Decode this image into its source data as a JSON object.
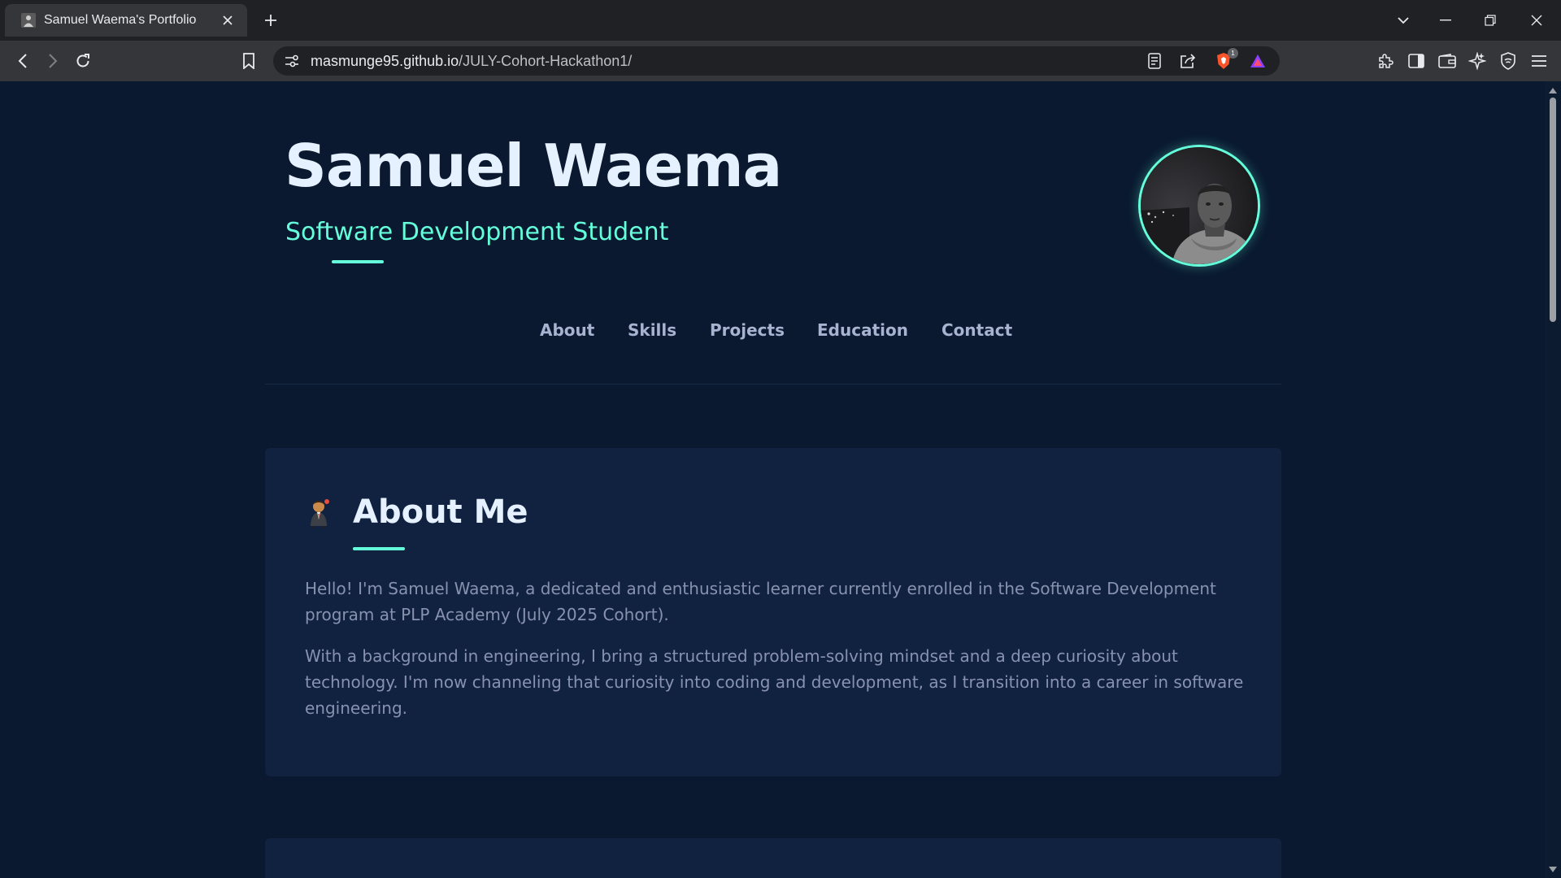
{
  "browser": {
    "tab": {
      "title": "Samuel Waema's Portfolio"
    },
    "address": {
      "host": "masmunge95.github.io",
      "path": "/JULY-Cohort-Hackathon1/"
    },
    "brave_shield_count": "1"
  },
  "hero": {
    "name": "Samuel Waema",
    "subtitle": "Software Development Student"
  },
  "nav": {
    "items": [
      "About",
      "Skills",
      "Projects",
      "Education",
      "Contact"
    ]
  },
  "about": {
    "title": "About Me",
    "paragraphs": [
      "Hello! I'm Samuel Waema, a dedicated and enthusiastic learner currently enrolled in the Software Development program at PLP Academy (July 2025 Cohort).",
      "With a background in engineering, I bring a structured problem-solving mindset and a deep curiosity about technology. I'm now channeling that curiosity into coding and development, as I transition into a career in software engineering."
    ]
  },
  "colors": {
    "page_bg": "#0a192f",
    "card_bg": "#112240",
    "accent": "#64ffda",
    "heading": "#e6f1ff",
    "nav_text": "#a8b2d1",
    "body_text": "#8892b0"
  },
  "icons": [
    "profile-favicon-icon",
    "close-icon",
    "plus-icon",
    "chevron-down-icon",
    "minimize-icon",
    "restore-icon",
    "back-icon",
    "forward-icon",
    "reload-icon",
    "bookmark-icon",
    "site-settings-icon",
    "reader-mode-icon",
    "share-icon",
    "brave-shields-icon",
    "brave-rewards-icon",
    "extensions-icon",
    "sidebar-icon",
    "wallet-icon",
    "leo-ai-icon",
    "vpn-icon",
    "menu-icon",
    "person-emoji-icon"
  ]
}
